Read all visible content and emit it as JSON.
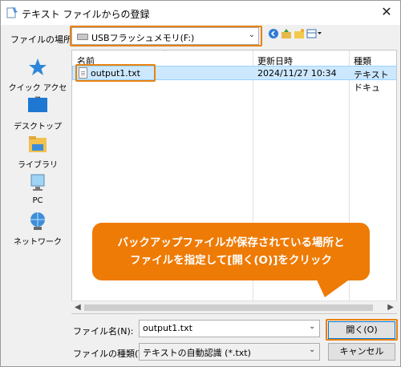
{
  "window": {
    "title": "テキスト ファイルからの登録",
    "close_glyph": "✕"
  },
  "location": {
    "label": "ファイルの場所(I):",
    "value": "USBフラッシュメモリ(F:)"
  },
  "places": [
    {
      "label": "クイック アクセス",
      "icon": "star-icon"
    },
    {
      "label": "デスクトップ",
      "icon": "desktop-icon"
    },
    {
      "label": "ライブラリ",
      "icon": "library-folder-icon"
    },
    {
      "label": "PC",
      "icon": "computer-icon"
    },
    {
      "label": "ネットワーク",
      "icon": "network-icon"
    }
  ],
  "filelist": {
    "columns": [
      "名前",
      "更新日時",
      "種類"
    ],
    "rows": [
      {
        "name": "output1.txt",
        "modified": "2024/11/27 10:34",
        "type": "テキスト ドキュ"
      }
    ]
  },
  "callout": {
    "line1": "バックアップファイルが保存されている場所と",
    "line2": "ファイルを指定して[開く(O)]をクリック"
  },
  "filename": {
    "label": "ファイル名(N):",
    "value": "output1.txt"
  },
  "filetype": {
    "label": "ファイルの種類(T):",
    "value": "テキストの自動認識 (*.txt)"
  },
  "buttons": {
    "open": "開く(O)",
    "cancel": "キャンセル"
  },
  "colors": {
    "highlight": "#e8810f",
    "callout": "#ee7b06",
    "selection": "#cce8ff"
  }
}
